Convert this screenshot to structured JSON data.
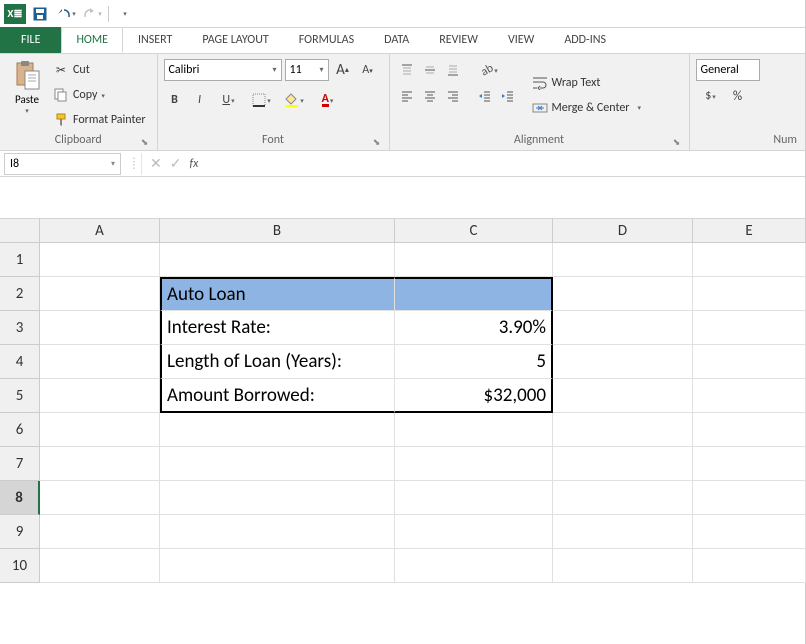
{
  "qat": {
    "save": "💾",
    "undo": "↶",
    "redo": "↷"
  },
  "tabs": {
    "file": "FILE",
    "home": "HOME",
    "insert": "INSERT",
    "page_layout": "PAGE LAYOUT",
    "formulas": "FORMULAS",
    "data": "DATA",
    "review": "REVIEW",
    "view": "VIEW",
    "addins": "ADD-INS"
  },
  "clipboard": {
    "paste": "Paste",
    "cut": "Cut",
    "copy": "Copy",
    "fp": "Format Painter",
    "label": "Clipboard"
  },
  "font": {
    "name": "Calibri",
    "size": "11",
    "label": "Font"
  },
  "alignment": {
    "wrap": "Wrap Text",
    "merge": "Merge & Center",
    "label": "Alignment"
  },
  "number": {
    "format": "General",
    "currency": "$",
    "label": "Num"
  },
  "namebox": "I8",
  "formula": "",
  "columns": [
    "A",
    "B",
    "C",
    "D",
    "E"
  ],
  "rows": [
    "1",
    "2",
    "3",
    "4",
    "5",
    "6",
    "7",
    "8",
    "9",
    "10"
  ],
  "sheet": {
    "b2": "Auto Loan",
    "b3": "Interest Rate:",
    "c3": "3.90%",
    "b4": "Length of Loan (Years):",
    "c4": "5",
    "b5": "Amount Borrowed:",
    "c5": "$32,000"
  }
}
